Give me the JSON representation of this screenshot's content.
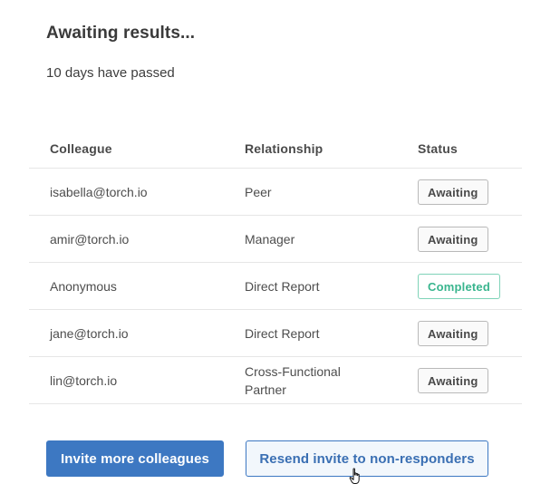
{
  "header": {
    "title": "Awaiting results...",
    "subtitle": "10 days have passed"
  },
  "table": {
    "columns": [
      "Colleague",
      "Relationship",
      "Status"
    ],
    "rows": [
      {
        "colleague": "isabella@torch.io",
        "relationship": "Peer",
        "status": "Awaiting"
      },
      {
        "colleague": "amir@torch.io",
        "relationship": "Manager",
        "status": "Awaiting"
      },
      {
        "colleague": "Anonymous",
        "relationship": "Direct Report",
        "status": "Completed"
      },
      {
        "colleague": "jane@torch.io",
        "relationship": "Direct Report",
        "status": "Awaiting"
      },
      {
        "colleague": "lin@torch.io",
        "relationship": "Cross-Functional Partner",
        "status": "Awaiting"
      }
    ]
  },
  "actions": {
    "invite_label": "Invite more colleagues",
    "resend_label": "Resend invite to non-responders"
  },
  "colors": {
    "primary": "#3d78c2",
    "completed": "#39b58e",
    "awaiting_border": "#b9b9b9"
  },
  "icons": {
    "cursor": "hand-pointer-icon"
  }
}
